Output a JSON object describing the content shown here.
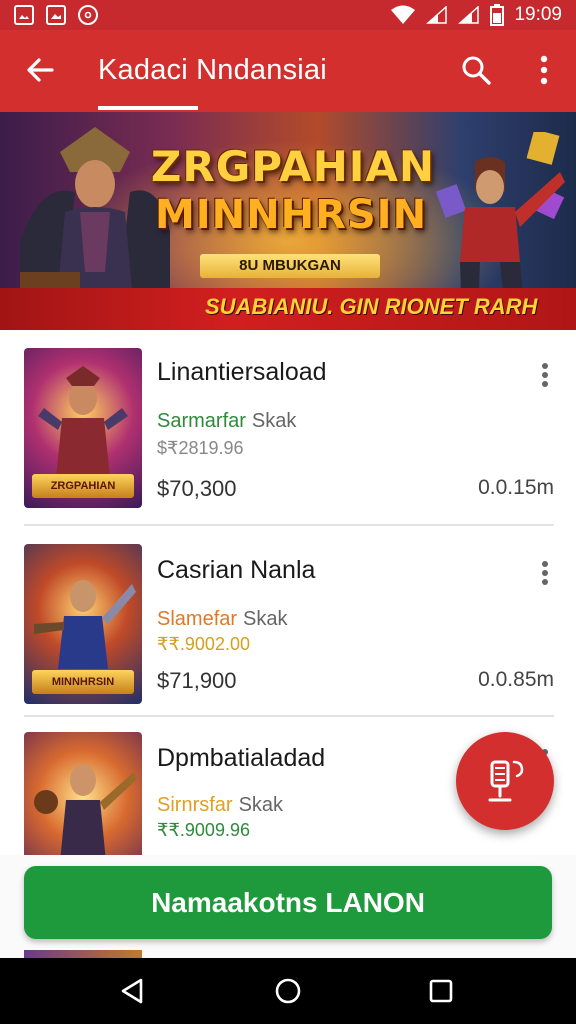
{
  "status_bar": {
    "time": "19:09",
    "left_icons": [
      "photo-notification-icon",
      "image-notification-icon",
      "data-saver-icon"
    ],
    "right_icons": [
      "wifi-icon",
      "signal-icon",
      "signal-icon",
      "battery-icon"
    ]
  },
  "app_bar": {
    "title": "Kadaci Nndansiai",
    "back_icon": "arrow-back-icon",
    "search_icon": "search-icon",
    "more_icon": "more-vert-icon"
  },
  "banner": {
    "title_line1": "ZRGPAHIAN",
    "title_line2": "MINNHRSIN",
    "subtitle": "8U MBUKGAN",
    "tagline": "SUABIANIU. GIN RIONET RARH"
  },
  "games": [
    {
      "name": "Linantiersaload",
      "category": "Sarmarfar",
      "category_suffix": "Skak",
      "category_color": "#2e8b3a",
      "count": "$₹2819.96",
      "count_color": "#888888",
      "price": "$70,300",
      "size": "0.0.15m"
    },
    {
      "name": "Casrian Nanla",
      "category": "Slamefar",
      "category_suffix": "Skak",
      "category_color": "#e0782a",
      "count": "₹₹.9002.00",
      "count_color": "#d3a020",
      "price": "$71,900",
      "size": "0.0.85m"
    },
    {
      "name": "Dpmbatialadad",
      "category": "Sirnrsfar",
      "category_suffix": "Skak",
      "category_color": "#e0a020",
      "count": "₹₹.9009.96",
      "count_color": "#2e8b3a",
      "price": "",
      "size": ""
    }
  ],
  "fab": {
    "icon": "voice-record-icon"
  },
  "primary_button": {
    "label": "Namaakotns LANON"
  },
  "nav": {
    "back_icon": "nav-back-icon",
    "home_icon": "nav-home-icon",
    "recents_icon": "nav-recents-icon"
  }
}
